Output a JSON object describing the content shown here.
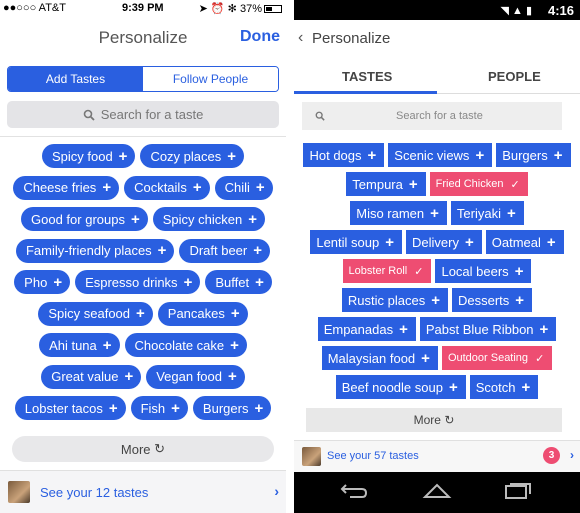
{
  "ios": {
    "status": {
      "carrier": "●●○○○ AT&T",
      "time": "9:39 PM",
      "battery": "37%"
    },
    "title": "Personalize",
    "done": "Done",
    "tabs": [
      "Add Tastes",
      "Follow People"
    ],
    "search_placeholder": "Search for a taste",
    "chip_rows": [
      [
        "Spicy food",
        "Cozy places"
      ],
      [
        "Cheese fries",
        "Cocktails",
        "Chili"
      ],
      [
        "Good for groups",
        "Spicy chicken"
      ],
      [
        "Family-friendly places",
        "Draft beer"
      ],
      [
        "Pho",
        "Espresso drinks",
        "Buffet"
      ],
      [
        "Spicy seafood",
        "Pancakes"
      ],
      [
        "Ahi tuna",
        "Chocolate cake"
      ],
      [
        "Great value",
        "Vegan food"
      ],
      [
        "Lobster tacos",
        "Fish",
        "Burgers"
      ]
    ],
    "more": "More",
    "footer": "See your 12 tastes"
  },
  "android": {
    "status_time": "4:16",
    "title": "Personalize",
    "tabs": [
      "TASTES",
      "PEOPLE"
    ],
    "search_placeholder": "Search for a taste",
    "chip_rows": [
      [
        {
          "label": "Hot dogs",
          "selected": false
        },
        {
          "label": "Scenic views",
          "selected": false
        },
        {
          "label": "Burgers",
          "selected": false
        }
      ],
      [
        {
          "label": "Tempura",
          "selected": false
        },
        {
          "label": "Fried Chicken",
          "selected": true
        }
      ],
      [
        {
          "label": "Miso ramen",
          "selected": false
        },
        {
          "label": "Teriyaki",
          "selected": false
        }
      ],
      [
        {
          "label": "Lentil soup",
          "selected": false
        },
        {
          "label": "Delivery",
          "selected": false
        },
        {
          "label": "Oatmeal",
          "selected": false
        }
      ],
      [
        {
          "label": "Lobster Roll",
          "selected": true
        },
        {
          "label": "Local beers",
          "selected": false
        }
      ],
      [
        {
          "label": "Rustic places",
          "selected": false
        },
        {
          "label": "Desserts",
          "selected": false
        }
      ],
      [
        {
          "label": "Empanadas",
          "selected": false
        },
        {
          "label": "Pabst Blue Ribbon",
          "selected": false
        }
      ],
      [
        {
          "label": "Malaysian food",
          "selected": false
        },
        {
          "label": "Outdoor Seating",
          "selected": true
        }
      ],
      [
        {
          "label": "Beef noodle soup",
          "selected": false
        },
        {
          "label": "Scotch",
          "selected": false
        }
      ]
    ],
    "more": "More",
    "footer": "See your 57 tastes",
    "badge": "3"
  },
  "colors": {
    "accent": "#2a5fe0",
    "selected": "#ee4d72"
  }
}
